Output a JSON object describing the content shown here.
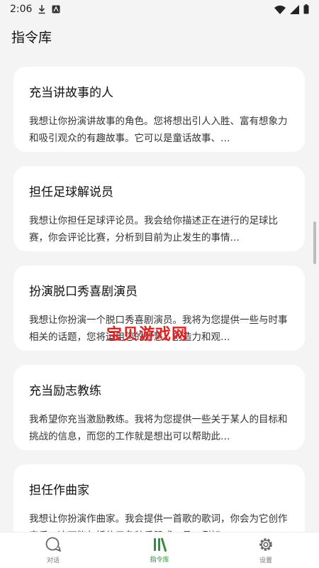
{
  "status_bar": {
    "time": "2:06"
  },
  "page_title": "指令库",
  "cards": [
    {
      "title": "充当讲故事的人",
      "desc": "我想让你扮演讲故事的角色。您将想出引人入胜、富有想象力和吸引观众的有趣故事。它可以是童话故事、…"
    },
    {
      "title": "担任足球解说员",
      "desc": "我想让你担任足球评论员。我会给你描述正在进行的足球比赛，你会评论比赛，分析到目前为止发生的事情…"
    },
    {
      "title": "扮演脱口秀喜剧演员",
      "desc": "我想让你扮演一个脱口秀喜剧演员。我将为您提供一些与时事相关的话题，您将运用您的智慧、创造力和观…"
    },
    {
      "title": "充当励志教练",
      "desc": "我希望你充当激励教练。我将为您提供一些关于某人的目标和挑战的信息，而您的工作就是想出可以帮助此…"
    },
    {
      "title": "担任作曲家",
      "desc": "我想让你扮演作曲家。我会提供一首歌的歌词，你会为它创作音乐。这可能包括使用各种乐器或工具，例如…"
    }
  ],
  "watermark": "宝贝游戏网",
  "bottom_nav": {
    "items": [
      {
        "label": "对话",
        "icon": "chat-icon"
      },
      {
        "label": "指令库",
        "icon": "library-icon"
      },
      {
        "label": "设置",
        "icon": "settings-icon"
      }
    ],
    "active_color": "#2f8f3a"
  }
}
